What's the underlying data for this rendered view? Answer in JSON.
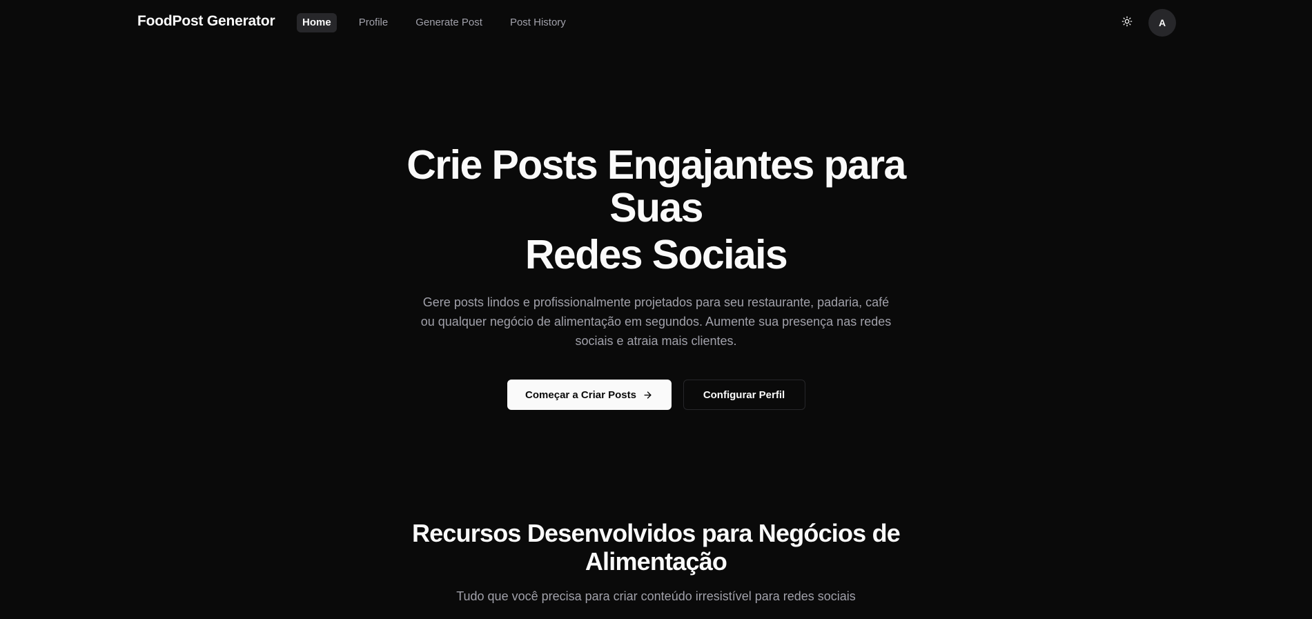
{
  "nav": {
    "brand": "FoodPost Generator",
    "links": [
      {
        "label": "Home",
        "active": true
      },
      {
        "label": "Profile",
        "active": false
      },
      {
        "label": "Generate Post",
        "active": false
      },
      {
        "label": "Post History",
        "active": false
      }
    ],
    "theme_toggle_icon": "sun-icon",
    "avatar_initial": "A"
  },
  "hero": {
    "title_line1": "Crie Posts Engajantes para Suas",
    "title_line2": "Redes Sociais",
    "subtitle": "Gere posts lindos e profissionalmente projetados para seu restaurante, padaria, café ou qualquer negócio de alimentação em segundos. Aumente sua presença nas redes sociais e atraia mais clientes.",
    "primary_button": "Começar a Criar Posts",
    "primary_button_icon": "arrow-right-icon",
    "secondary_button": "Configurar Perfil"
  },
  "features": {
    "title": "Recursos Desenvolvidos para Negócios de Alimentação",
    "subtitle": "Tudo que você precisa para criar conteúdo irresistível para redes sociais"
  },
  "colors": {
    "background": "#0a0a0a",
    "foreground": "#fafafa",
    "muted": "#a1a1aa",
    "border": "#27272a"
  }
}
